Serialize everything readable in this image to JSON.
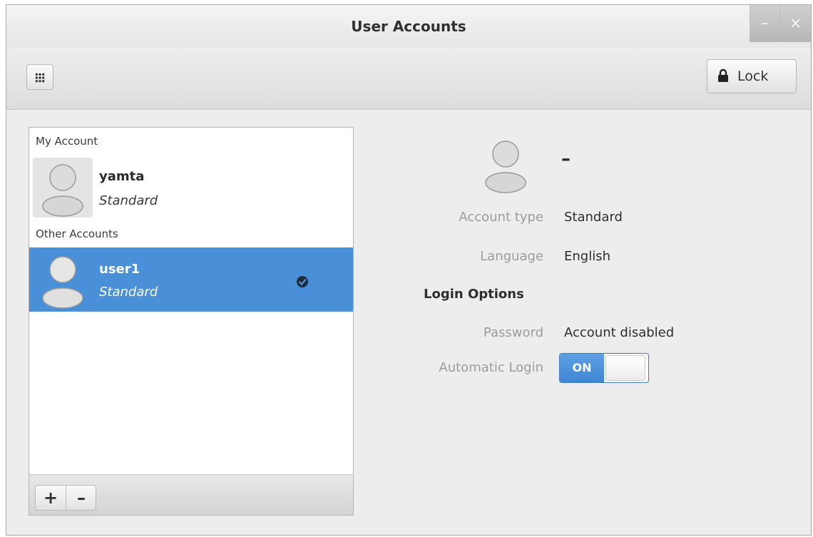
{
  "window": {
    "title": "User Accounts",
    "minimize_glyph": "–",
    "close_glyph": "×"
  },
  "toolbar": {
    "grid_icon": "app-grid-icon",
    "lock_icon": "lock-icon",
    "lock_label": "Lock"
  },
  "accounts": {
    "my_account_label": "My Account",
    "other_accounts_label": "Other Accounts",
    "my_account": {
      "name": "yamta",
      "type": "Standard"
    },
    "others": [
      {
        "name": "user1",
        "type": "Standard",
        "selected": true,
        "logged_in_icon": "check-icon"
      }
    ],
    "add_glyph": "+",
    "remove_glyph": "–"
  },
  "details": {
    "name": "–",
    "fields": {
      "account_type_label": "Account type",
      "account_type_value": "Standard",
      "language_label": "Language",
      "language_value": "English",
      "login_options_heading": "Login Options",
      "password_label": "Password",
      "password_value": "Account disabled",
      "auto_login_label": "Automatic Login",
      "auto_login_state": "ON"
    }
  },
  "colors": {
    "selection": "#4a90d9",
    "window_bg": "#ededed",
    "toggle_on": "#4a90d9"
  }
}
